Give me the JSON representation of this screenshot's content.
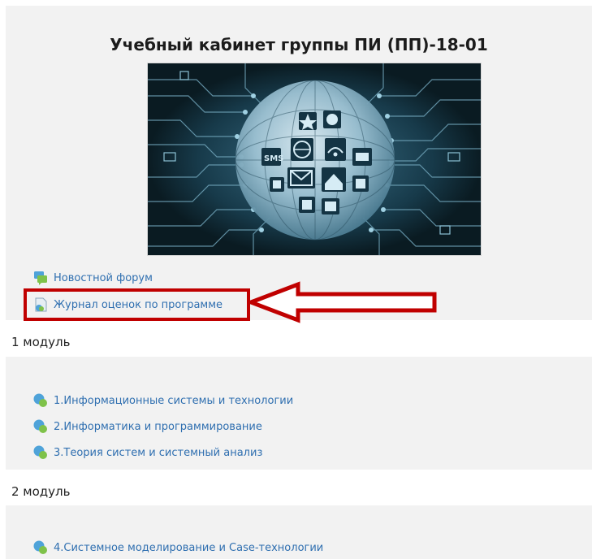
{
  "course": {
    "title": "Учебный кабинет группы ПИ (ПП)-18-01"
  },
  "banner": {
    "sms_label": "SMS"
  },
  "top_links": [
    {
      "label": "Новостной форум",
      "icon": "forum-icon"
    },
    {
      "label": "Журнал оценок по программе",
      "icon": "gradebook-icon"
    }
  ],
  "sections": [
    {
      "name": "1 модуль",
      "items": [
        {
          "label": "1.Информационные системы и технологии",
          "icon": "lesson-icon"
        },
        {
          "label": "2.Информатика и программирование",
          "icon": "lesson-icon"
        },
        {
          "label": "3.Теория систем и системный анализ",
          "icon": "lesson-icon"
        }
      ]
    },
    {
      "name": "2 модуль",
      "items": [
        {
          "label": "4.Системное моделирование и Case-технологии",
          "icon": "lesson-icon"
        }
      ]
    }
  ],
  "colors": {
    "link": "#2f6fb0",
    "highlight": "#c00000",
    "panel": "#f2f2f2"
  }
}
